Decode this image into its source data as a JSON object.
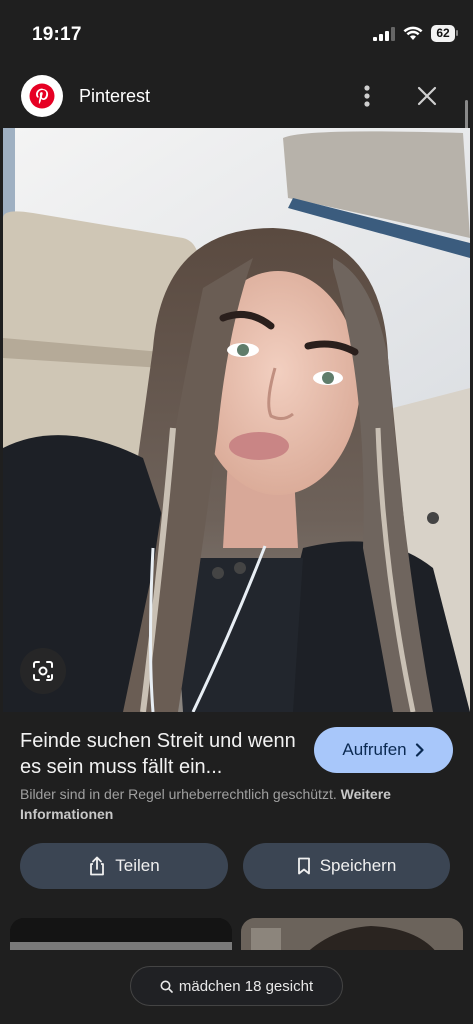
{
  "status_bar": {
    "time": "19:17",
    "battery": "62"
  },
  "header": {
    "app_name": "Pinterest",
    "brand_color": "#e60023"
  },
  "image": {
    "lens_icon": "google-lens-icon"
  },
  "result": {
    "title": "Feinde suchen Streit und wenn es sein muss fällt ein...",
    "open_label": "Aufrufen",
    "copyright_text": "Bilder sind in der Regel urheberrechtlich geschützt.",
    "more_info_label": "Weitere Informationen"
  },
  "actions": {
    "share_label": "Teilen",
    "save_label": "Speichern"
  },
  "search": {
    "query": "mädchen 18 gesicht"
  },
  "colors": {
    "background": "#1f1f1f",
    "primary_button": "#a8c7fa",
    "secondary_button": "#3b4553"
  }
}
